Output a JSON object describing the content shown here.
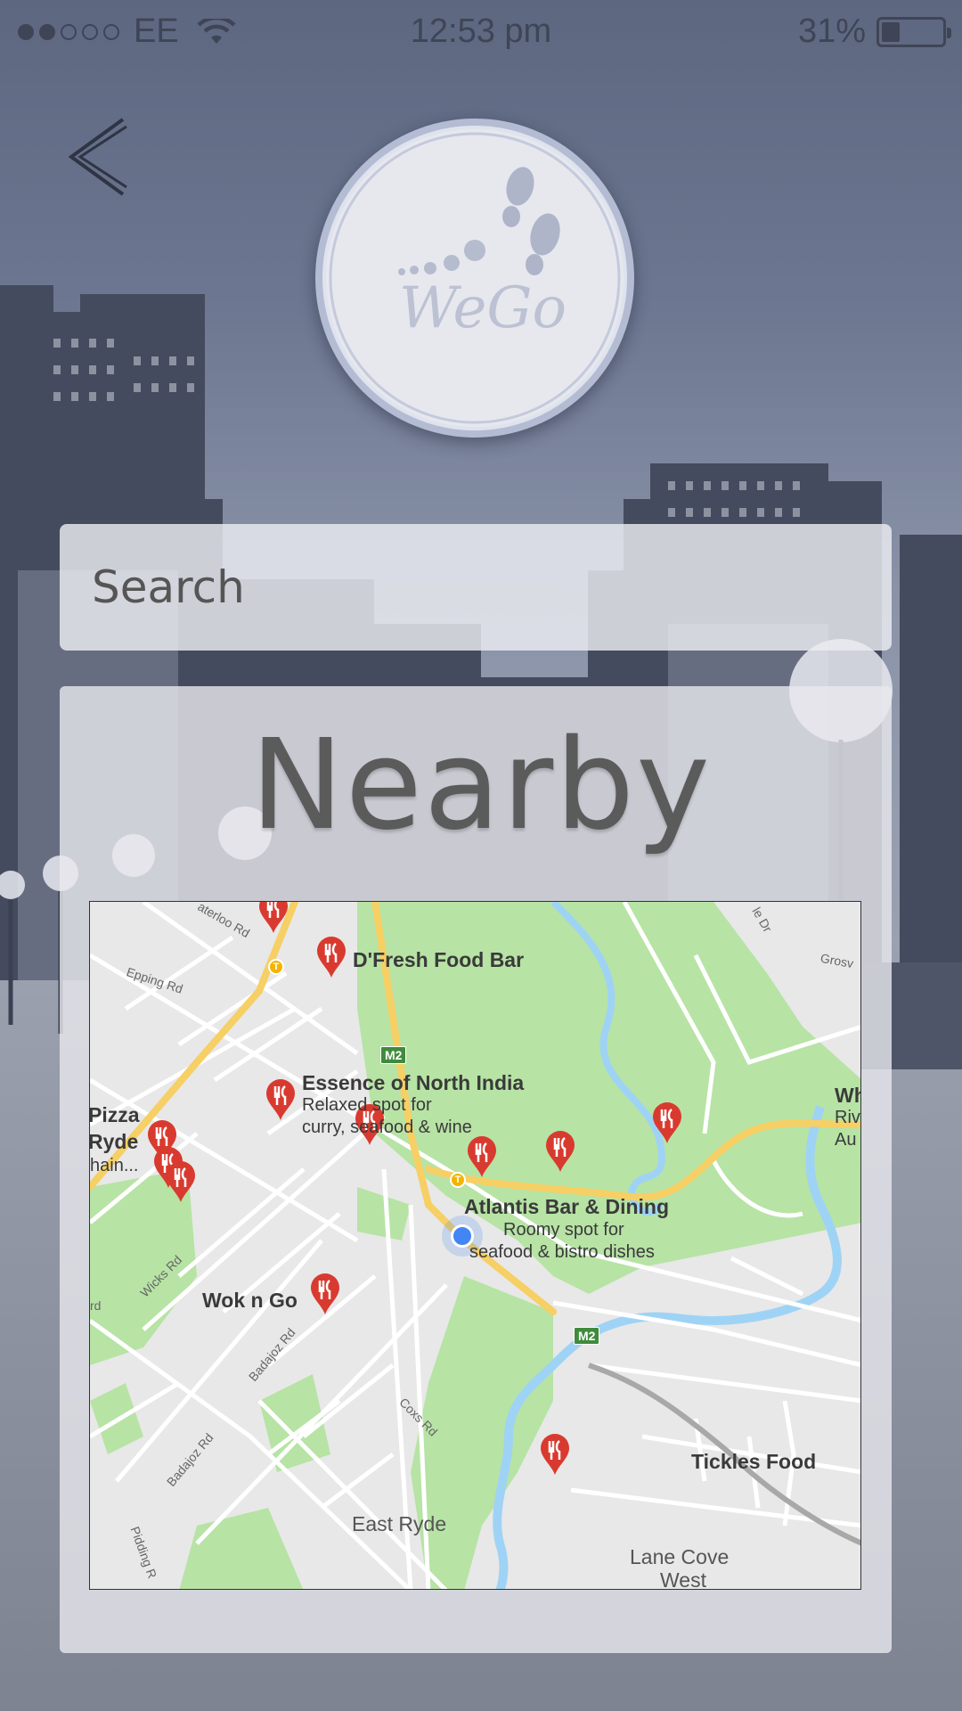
{
  "status_bar": {
    "carrier": "EE",
    "time": "12:53 pm",
    "battery": "31%",
    "battery_level": 0.31,
    "signal_bars_filled": 2,
    "signal_bars_total": 5
  },
  "header": {
    "back_icon": "chevron-left-icon",
    "logo_text": "WeGo"
  },
  "search": {
    "placeholder": "Search"
  },
  "nearby": {
    "title": "Nearby"
  },
  "map": {
    "places": [
      {
        "name": "D'Fresh Food Bar",
        "desc1": "",
        "desc2": ""
      },
      {
        "name": "Essence of North India",
        "desc1": "Relaxed spot for",
        "desc2": "curry, seafood & wine"
      },
      {
        "name": "Pizza",
        "desc1": "Ryde",
        "desc2": "hain..."
      },
      {
        "name": "Atlantis Bar & Dining",
        "desc1": "Roomy spot for",
        "desc2": "seafood & bistro dishes"
      },
      {
        "name": "Wok n Go",
        "desc1": "",
        "desc2": ""
      },
      {
        "name": "Tickles Food",
        "desc1": "",
        "desc2": ""
      },
      {
        "name": "Wh",
        "desc1": "Riv",
        "desc2": "Au"
      }
    ],
    "areas": [
      "East Ryde",
      "Lane Cove",
      "West"
    ],
    "roads": [
      "aterloo Rd",
      "Epping Rd",
      "Wicks Rd",
      "Badajoz Rd",
      "Badajoz Rd",
      "Coxs Rd",
      "Pidding R",
      "le Dr",
      "Grosv",
      "rd"
    ],
    "motorway_badges": [
      "M2",
      "M2"
    ],
    "colors": {
      "park": "#b7e3a5",
      "water": "#9fd3f5",
      "road": "#ffffff",
      "highway": "#f6cf65",
      "land": "#e8e8e8",
      "pin": "#d93a2f"
    }
  },
  "colors": {
    "background": "#7b8397",
    "panel": "#e8e9ee",
    "logo_ring": "#b4bcd3"
  }
}
